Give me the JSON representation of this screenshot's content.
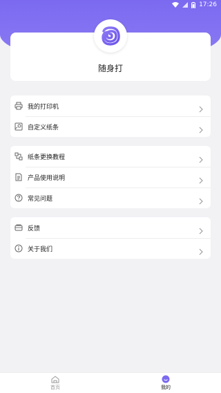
{
  "status_bar": {
    "time": "17:26"
  },
  "app": {
    "name": "随身打"
  },
  "groups": [
    {
      "items": [
        {
          "label": "我的打印机",
          "icon": "printer-icon"
        },
        {
          "label": "自定义纸条",
          "icon": "custom-paper-icon"
        }
      ]
    },
    {
      "items": [
        {
          "label": "纸条更换教程",
          "icon": "tutorial-icon"
        },
        {
          "label": "产品使用说明",
          "icon": "manual-icon"
        },
        {
          "label": "常见问题",
          "icon": "question-icon"
        }
      ]
    },
    {
      "items": [
        {
          "label": "反馈",
          "icon": "feedback-icon"
        },
        {
          "label": "关于我们",
          "icon": "info-icon"
        }
      ]
    }
  ],
  "tabbar": {
    "home": "首页",
    "mine": "我的"
  },
  "colors": {
    "accent": "#7B6AF0",
    "background": "#F2F2F5"
  }
}
